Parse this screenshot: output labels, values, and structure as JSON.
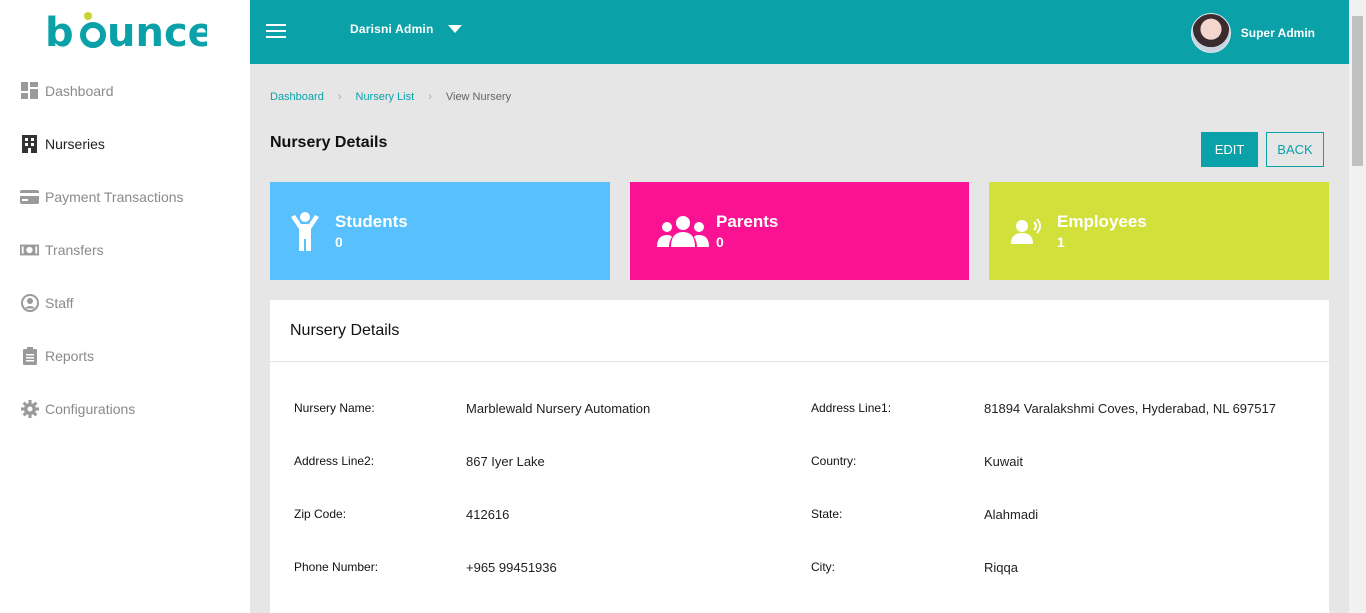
{
  "sidebar": {
    "items": [
      {
        "label": "Dashboard",
        "icon": "dashboard-icon"
      },
      {
        "label": "Nurseries",
        "icon": "building-icon"
      },
      {
        "label": "Payment Transactions",
        "icon": "credit-card-icon"
      },
      {
        "label": "Transfers",
        "icon": "money-icon"
      },
      {
        "label": "Staff",
        "icon": "user-circle-icon"
      },
      {
        "label": "Reports",
        "icon": "clipboard-icon"
      },
      {
        "label": "Configurations",
        "icon": "gear-icon"
      }
    ]
  },
  "header": {
    "admin_selector": "Darisni Admin",
    "user_name": "Super Admin"
  },
  "breadcrumb": {
    "items": [
      "Dashboard",
      "Nursery List",
      "View Nursery"
    ]
  },
  "page": {
    "title": "Nursery Details",
    "edit_label": "EDIT",
    "back_label": "BACK"
  },
  "stats": [
    {
      "title": "Students",
      "value": "0",
      "color": "#58c0fc"
    },
    {
      "title": "Parents",
      "value": "0",
      "color": "#fb1292"
    },
    {
      "title": "Employees",
      "value": "1",
      "color": "#d2e03c"
    }
  ],
  "details": {
    "heading": "Nursery Details",
    "fields": [
      {
        "label": "Nursery Name:",
        "value": "Marblewald Nursery Automation"
      },
      {
        "label": "Address Line1:",
        "value": "81894 Varalakshmi Coves, Hyderabad, NL 697517"
      },
      {
        "label": "Address Line2:",
        "value": "867 Iyer Lake"
      },
      {
        "label": "Country:",
        "value": "Kuwait"
      },
      {
        "label": "Zip Code:",
        "value": "412616"
      },
      {
        "label": "State:",
        "value": "Alahmadi"
      },
      {
        "label": "Phone Number:",
        "value": "+965 99451936"
      },
      {
        "label": "City:",
        "value": "Riqqa"
      }
    ]
  },
  "colors": {
    "accent": "#0aa1a8",
    "students": "#58c0fc",
    "parents": "#fb1292",
    "employees": "#d2e03c"
  }
}
